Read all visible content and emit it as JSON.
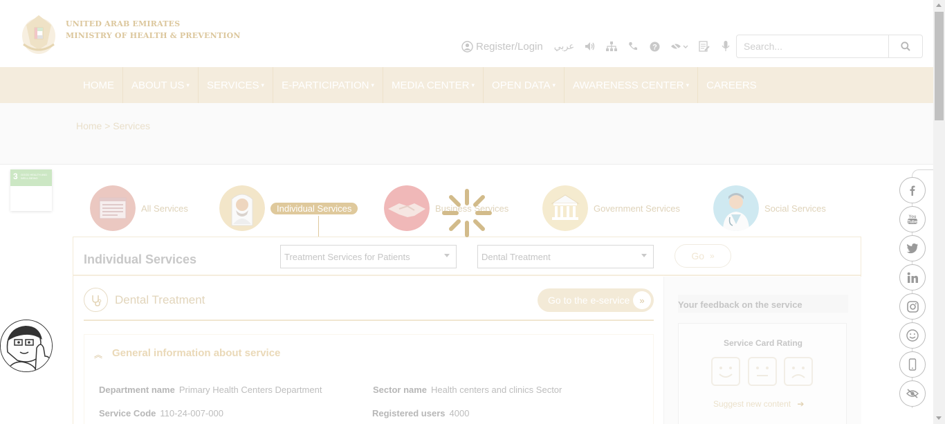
{
  "header": {
    "logo_line1": "UNITED ARAB EMIRATES",
    "logo_line2": "MINISTRY OF HEALTH & PREVENTION",
    "register_label": "Register/Login",
    "arabic_label": "عربي",
    "tool_icons": [
      "speaker-icon",
      "sitemap-icon",
      "phone-icon",
      "help-icon",
      "eye-slash-icon",
      "document-icon",
      "microphone-icon"
    ],
    "search_placeholder": "Search..."
  },
  "nav": {
    "items": [
      {
        "label": "HOME",
        "dropdown": false
      },
      {
        "label": "ABOUT US",
        "dropdown": true
      },
      {
        "label": "SERVICES",
        "dropdown": true
      },
      {
        "label": "E-PARTICIPATION",
        "dropdown": true
      },
      {
        "label": "MEDIA CENTER",
        "dropdown": true
      },
      {
        "label": "OPEN DATA",
        "dropdown": true
      },
      {
        "label": "AWARENESS CENTER",
        "dropdown": true
      },
      {
        "label": "CAREERS",
        "dropdown": false
      }
    ]
  },
  "breadcrumb": "Home > Services",
  "sdg": {
    "number": "3",
    "text": "GOOD HEALTH AND WELL-BEING"
  },
  "categories": [
    {
      "label": "All Services",
      "active": false
    },
    {
      "label": "Individual Services",
      "active": true
    },
    {
      "label": "Business Services",
      "active": false
    },
    {
      "label": "Government Services",
      "active": false
    },
    {
      "label": "Social Services",
      "active": false
    }
  ],
  "filter": {
    "title": "Individual Services",
    "category_value": "Treatment Services for Patients",
    "service_value": "Dental Treatment",
    "go_label": "Go"
  },
  "service": {
    "title": "Dental Treatment",
    "eservice_label": "Go to the e-service",
    "general_title": "General information about service",
    "fields": [
      {
        "label": "Department name",
        "value": "Primary Health Centers Department"
      },
      {
        "label": "Sector name",
        "value": "Health centers and clinics Sector"
      },
      {
        "label": "Service Code",
        "value": "110-24-007-000"
      },
      {
        "label": "Registered users",
        "value": "4000"
      }
    ]
  },
  "feedback": {
    "title": "Your feedback on the service",
    "rating_title": "Service Card Rating",
    "suggest_label": "Suggest new content"
  },
  "social": [
    "facebook-icon",
    "youtube-icon",
    "twitter-icon",
    "linkedin-icon",
    "instagram-icon",
    "smiley-icon",
    "mobile-icon",
    "eye-slash-icon"
  ],
  "colors": {
    "nav_bg": "#f4ecdd",
    "accent": "#dfc99c",
    "loader": "#d2bb8a"
  }
}
